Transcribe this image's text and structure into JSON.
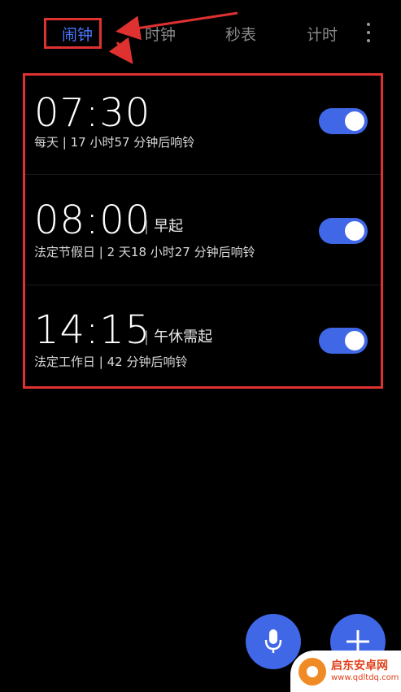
{
  "tabs": {
    "alarm": "闹钟",
    "clock": "时钟",
    "stopwatch": "秒表",
    "timer": "计时"
  },
  "accent_color": "#4a78ff",
  "toggle_color": "#3f67e6",
  "annotation_color": "#e03131",
  "alarms": [
    {
      "time": "07:30",
      "label": "",
      "subtitle": "每天 | 17 小时57 分钟后响铃",
      "enabled": true
    },
    {
      "time": "08:00",
      "label": "早起",
      "subtitle": "法定节假日 | 2 天18 小时27 分钟后响铃",
      "enabled": true
    },
    {
      "time": "14:15",
      "label": "午休需起",
      "subtitle": "法定工作日 | 42 分钟后响铃",
      "enabled": true
    }
  ],
  "label_separator": "|",
  "icons": {
    "more": "more-vertical-icon",
    "mic": "microphone-icon",
    "add": "plus-icon"
  },
  "watermark": {
    "title": "启东安卓网",
    "url": "www.qdltdq.com"
  }
}
